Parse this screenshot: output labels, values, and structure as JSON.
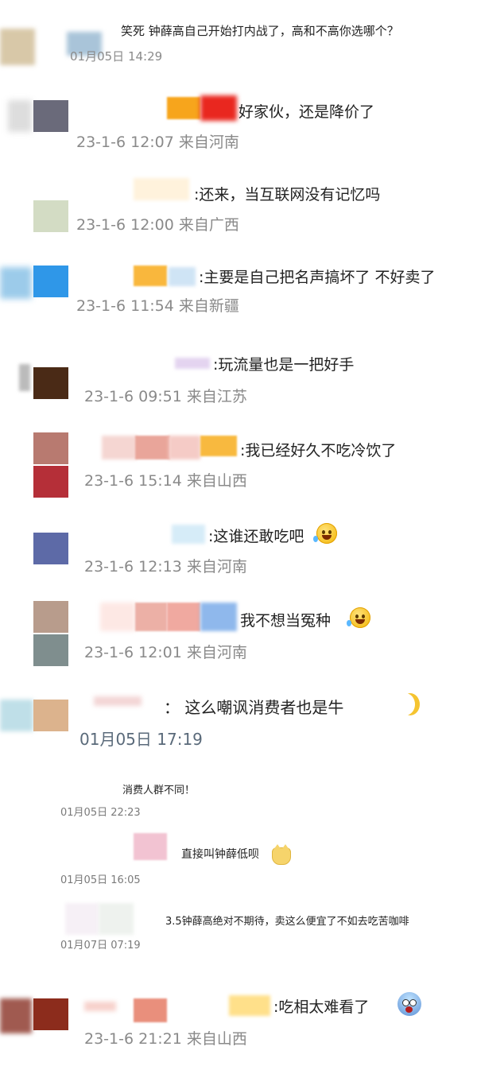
{
  "comments": [
    {
      "text": "笑死 钟薛高自己开始打内战了，高和不高你选哪个？",
      "time": "01月05日 14:29"
    },
    {
      "text": "好家伙，还是降价了",
      "time": "23-1-6 12:07 来自河南"
    },
    {
      "text": ":还来，当互联网没有记忆吗",
      "time": "23-1-6 12:00 来自广西"
    },
    {
      "text": ":主要是自己把名声搞坏了 不好卖了",
      "time": "23-1-6 11:54 来自新疆"
    },
    {
      "text": ":玩流量也是一把好手",
      "time": "23-1-6 09:51 来自江苏"
    },
    {
      "text": ":我已经好久不吃冷饮了",
      "time": "23-1-6 15:14 来自山西"
    },
    {
      "text": ":这谁还敢吃吧",
      "time": "23-1-6 12:13 来自河南"
    },
    {
      "text": "我不想当冤种",
      "time": "23-1-6 12:01 来自河南"
    },
    {
      "text": "： 这么嘲讽消费者也是牛",
      "time": "01月05日 17:19"
    },
    {
      "text": "消费人群不同！",
      "time": "01月05日 22:23"
    },
    {
      "text": "直接叫钟薛低呗",
      "time": "01月05日 16:05"
    },
    {
      "text": "3.5钟薛高绝对不期待，卖这么便宜了不如去吃苦咖啡",
      "time": "01月07日 07:19"
    },
    {
      "text": ":吃相太难看了",
      "time": "23-1-6 21:21 来自山西"
    }
  ],
  "icons": {
    "laugh_cry": "laughing-crying-emoji",
    "moon": "moon-emoji",
    "cat": "cat-face-emoji",
    "scared": "scared-face-emoji"
  }
}
